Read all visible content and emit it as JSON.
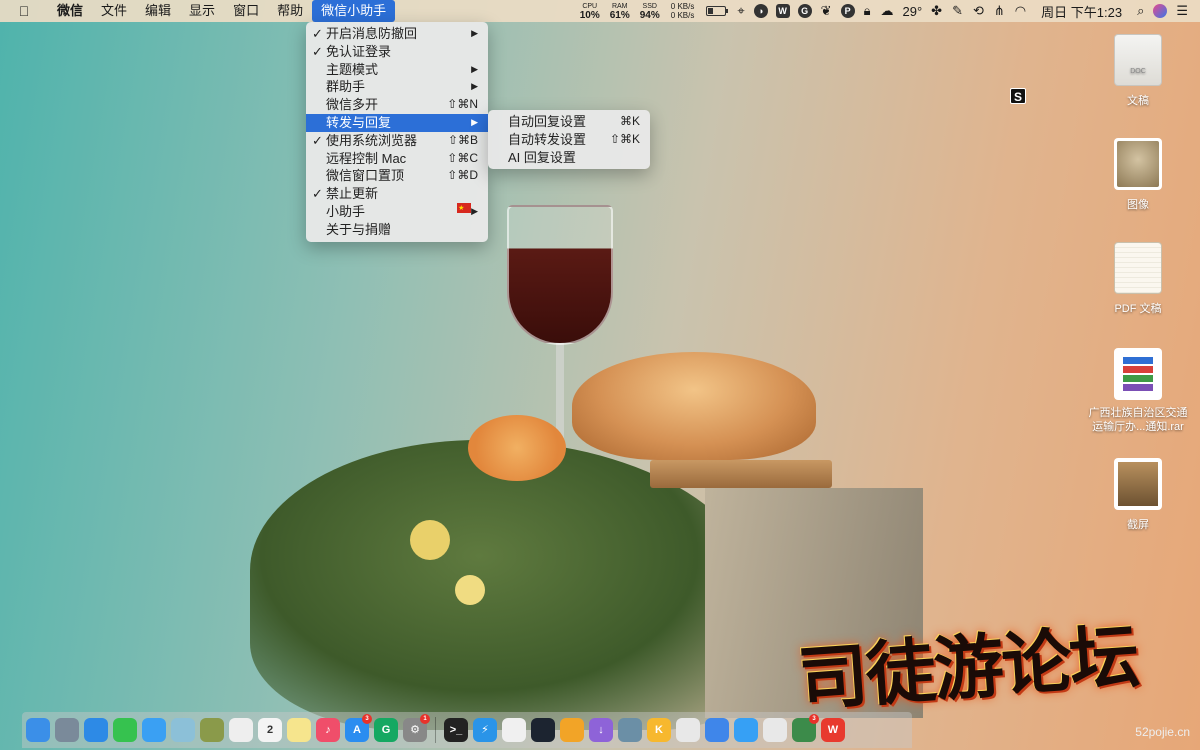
{
  "menubar": {
    "apple_icon": "apple-logo-icon",
    "items": [
      {
        "label": "微信"
      },
      {
        "label": "文件"
      },
      {
        "label": "编辑"
      },
      {
        "label": "显示"
      },
      {
        "label": "窗口"
      },
      {
        "label": "帮助"
      },
      {
        "label": "微信小助手"
      }
    ],
    "active_item": "微信小助手",
    "stats": {
      "cpu_label": "CPU",
      "cpu_value": "10%",
      "ram_label": "RAM",
      "ram_value": "61%",
      "ssd_label": "SSD",
      "ssd_value": "94%"
    },
    "network": {
      "up": "0 KB/s",
      "down": "0 KB/s"
    },
    "temperature": "29°",
    "clock": "周日 下午1:23",
    "tray_icons": [
      "battery-icon",
      "location-icon",
      "istat-icon",
      "w-app-icon",
      "grammarly-icon",
      "leaf-icon",
      "p-app-icon",
      "lock-icon",
      "weather-cloud-icon",
      "cluster-icon",
      "brush-icon",
      "time-machine-icon",
      "wechat-assistant-icon",
      "wifi-icon",
      "search-icon",
      "siri-icon",
      "notification-list-icon"
    ]
  },
  "main_menu": {
    "items": [
      {
        "label": "开启消息防撤回",
        "checked": true,
        "submenu": true,
        "shortcut": ""
      },
      {
        "label": "免认证登录",
        "checked": true,
        "submenu": false,
        "shortcut": ""
      },
      {
        "label": "主题模式",
        "checked": false,
        "submenu": true,
        "shortcut": ""
      },
      {
        "label": "群助手",
        "checked": false,
        "submenu": true,
        "shortcut": ""
      },
      {
        "label": "微信多开",
        "checked": false,
        "submenu": false,
        "shortcut": "⇧⌘N"
      },
      {
        "label": "转发与回复",
        "checked": false,
        "submenu": true,
        "shortcut": "",
        "highlighted": true
      },
      {
        "label": "使用系统浏览器",
        "checked": true,
        "submenu": false,
        "shortcut": "⇧⌘B"
      },
      {
        "label": "远程控制 Mac",
        "checked": false,
        "submenu": false,
        "shortcut": "⇧⌘C"
      },
      {
        "label": "微信窗口置顶",
        "checked": false,
        "submenu": false,
        "shortcut": "⇧⌘D"
      },
      {
        "label": "禁止更新",
        "checked": true,
        "submenu": false,
        "shortcut": ""
      },
      {
        "label": "小助手",
        "checked": false,
        "submenu": true,
        "shortcut": "",
        "flag": true
      },
      {
        "label": "关于与捐赠",
        "checked": false,
        "submenu": false,
        "shortcut": ""
      }
    ],
    "check_glyph": "✓",
    "arrow_glyph": "▶"
  },
  "sub_menu": {
    "items": [
      {
        "label": "自动回复设置",
        "shortcut": "⌘K"
      },
      {
        "label": "自动转发设置",
        "shortcut": "⇧⌘K"
      },
      {
        "label": "AI 回复设置",
        "shortcut": ""
      }
    ]
  },
  "desktop_icons": [
    {
      "label": "文稿",
      "icon": "document-icon"
    },
    {
      "label": "图像",
      "icon": "image-icon"
    },
    {
      "label": "PDF 文稿",
      "icon": "pdf-document-icon"
    },
    {
      "label": "广西壮族自治区交通运输厅办...通知.rar",
      "icon": "rar-archive-icon"
    },
    {
      "label": "截屏",
      "icon": "screenshot-icon"
    }
  ],
  "s_badge": "S",
  "watermark": {
    "text": "司徒游论坛",
    "url": "52pojie.cn"
  },
  "dock": {
    "apps": [
      {
        "icon": "finder-icon",
        "color": "#3b8fe8",
        "label": ""
      },
      {
        "icon": "launchpad-icon",
        "color": "#7a8a9a",
        "label": ""
      },
      {
        "icon": "safari-icon",
        "color": "#2d8ae6",
        "label": ""
      },
      {
        "icon": "facetime-icon",
        "color": "#36c24f",
        "label": ""
      },
      {
        "icon": "messages-icon",
        "color": "#3aa0f3",
        "label": ""
      },
      {
        "icon": "photos-icon",
        "color": "#8cc0d8",
        "label": ""
      },
      {
        "icon": "notes-book-icon",
        "color": "#8a9a4a",
        "label": ""
      },
      {
        "icon": "reminders-icon",
        "color": "#eeeeee",
        "label": ""
      },
      {
        "icon": "calendar-icon",
        "color": "#f4f4f4",
        "label": "2"
      },
      {
        "icon": "notes-icon",
        "color": "#f6e58d",
        "label": ""
      },
      {
        "icon": "music-icon",
        "color": "#f04e6a",
        "label": "♪"
      },
      {
        "icon": "app-store-icon",
        "color": "#2b8df0",
        "label": "A",
        "badge": "3"
      },
      {
        "icon": "grammarly-icon",
        "color": "#15a862",
        "label": "G"
      },
      {
        "icon": "system-preferences-icon",
        "color": "#888888",
        "label": "⚙",
        "badge": "1"
      },
      {
        "icon": "terminal-icon",
        "color": "#222222",
        "label": ">_",
        "separator_before": true
      },
      {
        "icon": "thunder-icon",
        "color": "#2a94e8",
        "label": "⚡"
      },
      {
        "icon": "textedit-icon",
        "color": "#f0f0f0",
        "label": ""
      },
      {
        "icon": "istat-icon",
        "color": "#1c2430",
        "label": ""
      },
      {
        "icon": "chrome-canary-icon",
        "color": "#f2a427",
        "label": ""
      },
      {
        "icon": "downloader-icon",
        "color": "#8e63d8",
        "label": "↓"
      },
      {
        "icon": "image-viewer-icon",
        "color": "#6b8fa6",
        "label": ""
      },
      {
        "icon": "k-app-icon",
        "color": "#f7b82e",
        "label": "K"
      },
      {
        "icon": "chrome-icon",
        "color": "#e8e8e8",
        "label": ""
      },
      {
        "icon": "baidu-netdisk-icon",
        "color": "#3f86ea",
        "label": ""
      },
      {
        "icon": "aliyun-drive-icon",
        "color": "#36a0f5",
        "label": ""
      },
      {
        "icon": "youku-icon",
        "color": "#e8e8e8",
        "label": ""
      },
      {
        "icon": "earth-icon",
        "color": "#3c8b4a",
        "label": "",
        "badge": "3"
      },
      {
        "icon": "wps-icon",
        "color": "#e83a2e",
        "label": "W"
      }
    ]
  }
}
